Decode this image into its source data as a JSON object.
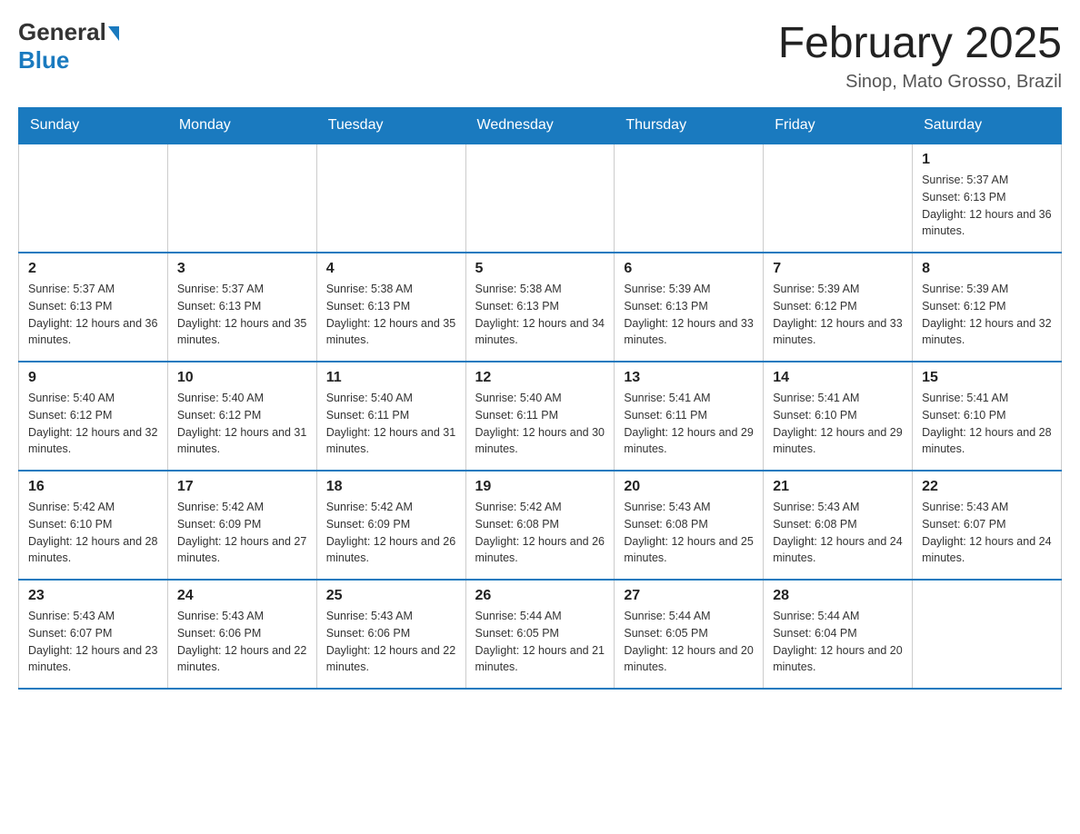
{
  "header": {
    "logo_general": "General",
    "logo_blue": "Blue",
    "month_title": "February 2025",
    "location": "Sinop, Mato Grosso, Brazil"
  },
  "days_of_week": [
    "Sunday",
    "Monday",
    "Tuesday",
    "Wednesday",
    "Thursday",
    "Friday",
    "Saturday"
  ],
  "weeks": [
    [
      {
        "day": "",
        "info": ""
      },
      {
        "day": "",
        "info": ""
      },
      {
        "day": "",
        "info": ""
      },
      {
        "day": "",
        "info": ""
      },
      {
        "day": "",
        "info": ""
      },
      {
        "day": "",
        "info": ""
      },
      {
        "day": "1",
        "info": "Sunrise: 5:37 AM\nSunset: 6:13 PM\nDaylight: 12 hours and 36 minutes."
      }
    ],
    [
      {
        "day": "2",
        "info": "Sunrise: 5:37 AM\nSunset: 6:13 PM\nDaylight: 12 hours and 36 minutes."
      },
      {
        "day": "3",
        "info": "Sunrise: 5:37 AM\nSunset: 6:13 PM\nDaylight: 12 hours and 35 minutes."
      },
      {
        "day": "4",
        "info": "Sunrise: 5:38 AM\nSunset: 6:13 PM\nDaylight: 12 hours and 35 minutes."
      },
      {
        "day": "5",
        "info": "Sunrise: 5:38 AM\nSunset: 6:13 PM\nDaylight: 12 hours and 34 minutes."
      },
      {
        "day": "6",
        "info": "Sunrise: 5:39 AM\nSunset: 6:13 PM\nDaylight: 12 hours and 33 minutes."
      },
      {
        "day": "7",
        "info": "Sunrise: 5:39 AM\nSunset: 6:12 PM\nDaylight: 12 hours and 33 minutes."
      },
      {
        "day": "8",
        "info": "Sunrise: 5:39 AM\nSunset: 6:12 PM\nDaylight: 12 hours and 32 minutes."
      }
    ],
    [
      {
        "day": "9",
        "info": "Sunrise: 5:40 AM\nSunset: 6:12 PM\nDaylight: 12 hours and 32 minutes."
      },
      {
        "day": "10",
        "info": "Sunrise: 5:40 AM\nSunset: 6:12 PM\nDaylight: 12 hours and 31 minutes."
      },
      {
        "day": "11",
        "info": "Sunrise: 5:40 AM\nSunset: 6:11 PM\nDaylight: 12 hours and 31 minutes."
      },
      {
        "day": "12",
        "info": "Sunrise: 5:40 AM\nSunset: 6:11 PM\nDaylight: 12 hours and 30 minutes."
      },
      {
        "day": "13",
        "info": "Sunrise: 5:41 AM\nSunset: 6:11 PM\nDaylight: 12 hours and 29 minutes."
      },
      {
        "day": "14",
        "info": "Sunrise: 5:41 AM\nSunset: 6:10 PM\nDaylight: 12 hours and 29 minutes."
      },
      {
        "day": "15",
        "info": "Sunrise: 5:41 AM\nSunset: 6:10 PM\nDaylight: 12 hours and 28 minutes."
      }
    ],
    [
      {
        "day": "16",
        "info": "Sunrise: 5:42 AM\nSunset: 6:10 PM\nDaylight: 12 hours and 28 minutes."
      },
      {
        "day": "17",
        "info": "Sunrise: 5:42 AM\nSunset: 6:09 PM\nDaylight: 12 hours and 27 minutes."
      },
      {
        "day": "18",
        "info": "Sunrise: 5:42 AM\nSunset: 6:09 PM\nDaylight: 12 hours and 26 minutes."
      },
      {
        "day": "19",
        "info": "Sunrise: 5:42 AM\nSunset: 6:08 PM\nDaylight: 12 hours and 26 minutes."
      },
      {
        "day": "20",
        "info": "Sunrise: 5:43 AM\nSunset: 6:08 PM\nDaylight: 12 hours and 25 minutes."
      },
      {
        "day": "21",
        "info": "Sunrise: 5:43 AM\nSunset: 6:08 PM\nDaylight: 12 hours and 24 minutes."
      },
      {
        "day": "22",
        "info": "Sunrise: 5:43 AM\nSunset: 6:07 PM\nDaylight: 12 hours and 24 minutes."
      }
    ],
    [
      {
        "day": "23",
        "info": "Sunrise: 5:43 AM\nSunset: 6:07 PM\nDaylight: 12 hours and 23 minutes."
      },
      {
        "day": "24",
        "info": "Sunrise: 5:43 AM\nSunset: 6:06 PM\nDaylight: 12 hours and 22 minutes."
      },
      {
        "day": "25",
        "info": "Sunrise: 5:43 AM\nSunset: 6:06 PM\nDaylight: 12 hours and 22 minutes."
      },
      {
        "day": "26",
        "info": "Sunrise: 5:44 AM\nSunset: 6:05 PM\nDaylight: 12 hours and 21 minutes."
      },
      {
        "day": "27",
        "info": "Sunrise: 5:44 AM\nSunset: 6:05 PM\nDaylight: 12 hours and 20 minutes."
      },
      {
        "day": "28",
        "info": "Sunrise: 5:44 AM\nSunset: 6:04 PM\nDaylight: 12 hours and 20 minutes."
      },
      {
        "day": "",
        "info": ""
      }
    ]
  ]
}
